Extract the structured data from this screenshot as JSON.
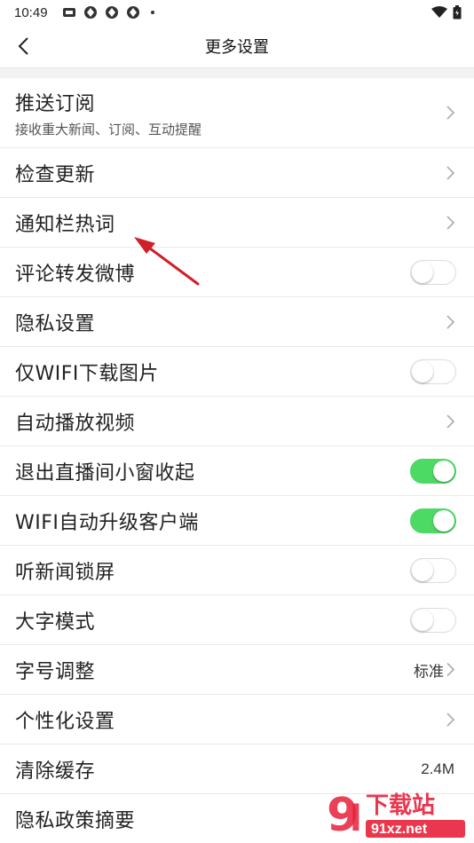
{
  "status_bar": {
    "time": "10:49",
    "left_icons": [
      "app-badge-icon",
      "notification-icon",
      "notification-icon",
      "notification-icon"
    ],
    "right_icons": [
      "wifi-icon",
      "battery-icon"
    ]
  },
  "nav": {
    "title": "更多设置",
    "back_icon": "chevron-left-icon"
  },
  "colors": {
    "toggle_on": "#4cd964",
    "annotation_arrow": "#d0202a"
  },
  "settings": [
    {
      "label": "推送订阅",
      "sublabel": "接收重大新闻、订阅、互动提醒",
      "control": "chevron"
    },
    {
      "label": "检查更新",
      "control": "chevron"
    },
    {
      "label": "通知栏热词",
      "control": "chevron"
    },
    {
      "label": "评论转发微博",
      "control": "toggle",
      "on": false
    },
    {
      "label": "隐私设置",
      "control": "chevron"
    },
    {
      "label": "仅WIFI下载图片",
      "control": "toggle",
      "on": false
    },
    {
      "label": "自动播放视频",
      "control": "chevron"
    },
    {
      "label": "退出直播间小窗收起",
      "control": "toggle",
      "on": true
    },
    {
      "label": "WIFI自动升级客户端",
      "control": "toggle",
      "on": true
    },
    {
      "label": "听新闻锁屏",
      "control": "toggle",
      "on": false
    },
    {
      "label": "大字模式",
      "control": "toggle",
      "on": false
    },
    {
      "label": "字号调整",
      "control": "value-chevron",
      "value": "标准"
    },
    {
      "label": "个性化设置",
      "control": "chevron"
    },
    {
      "label": "清除缓存",
      "control": "value",
      "value": "2.4M"
    },
    {
      "label": "隐私政策摘要",
      "control": "none"
    }
  ],
  "watermark": {
    "text": "下载站",
    "url_text": "91xz.net"
  }
}
